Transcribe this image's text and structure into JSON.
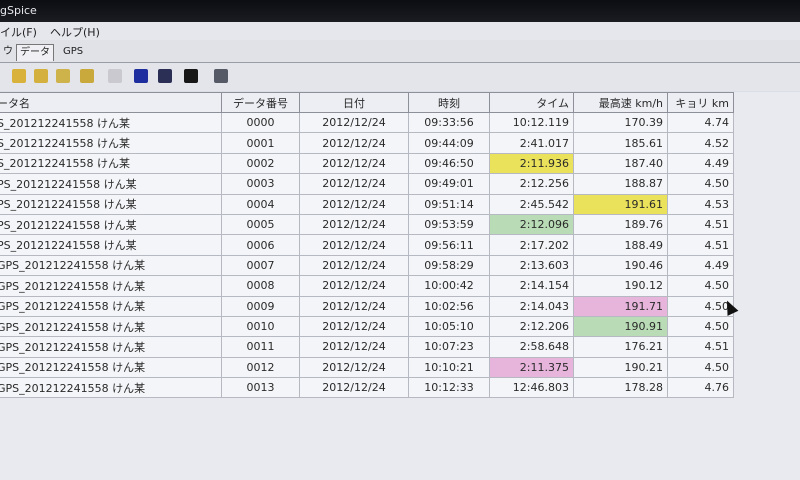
{
  "window": {
    "title": "gSpice"
  },
  "menu": {
    "file": "イル(F)",
    "help": "ヘルプ(H)"
  },
  "tabs": [
    {
      "label": "ウ"
    },
    {
      "label": "データ"
    },
    {
      "label": "GPS"
    }
  ],
  "toolbar": {
    "icons": [
      "open-folder-icon",
      "folder-icon",
      "folder-icon",
      "arrow-icon",
      "edit-icon",
      "save-icon",
      "search-icon",
      "save-icon",
      "table-icon"
    ]
  },
  "colors": {
    "yellow": "#e9e25a",
    "pink": "#e7b5dc",
    "green": "#b9dcb6"
  },
  "table": {
    "headers": [
      "ータ名",
      "データ番号",
      "日付",
      "時刻",
      "タイム",
      "最高速 km/h",
      "キョリ km"
    ],
    "rows": [
      [
        "S_201212241558 けん某",
        "0000",
        "2012/12/24",
        "09:33:56",
        "10:12.119",
        "170.39",
        "4.74"
      ],
      [
        "S_201212241558 けん某",
        "0001",
        "2012/12/24",
        "09:44:09",
        "2:41.017",
        "185.61",
        "4.52"
      ],
      [
        "S_201212241558 けん某",
        "0002",
        "2012/12/24",
        "09:46:50",
        "2:11.936",
        "187.40",
        "4.49"
      ],
      [
        "PS_201212241558 けん某",
        "0003",
        "2012/12/24",
        "09:49:01",
        "2:12.256",
        "188.87",
        "4.50"
      ],
      [
        "PS_201212241558 けん某",
        "0004",
        "2012/12/24",
        "09:51:14",
        "2:45.542",
        "191.61",
        "4.53"
      ],
      [
        "PS_201212241558 けん某",
        "0005",
        "2012/12/24",
        "09:53:59",
        "2:12.096",
        "189.76",
        "4.51"
      ],
      [
        "PS_201212241558 けん某",
        "0006",
        "2012/12/24",
        "09:56:11",
        "2:17.202",
        "188.49",
        "4.51"
      ],
      [
        "GPS_201212241558 けん某",
        "0007",
        "2012/12/24",
        "09:58:29",
        "2:13.603",
        "190.46",
        "4.49"
      ],
      [
        "GPS_201212241558 けん某",
        "0008",
        "2012/12/24",
        "10:00:42",
        "2:14.154",
        "190.12",
        "4.50"
      ],
      [
        "GPS_201212241558 けん某",
        "0009",
        "2012/12/24",
        "10:02:56",
        "2:14.043",
        "191.71",
        "4.50"
      ],
      [
        "GPS_201212241558 けん某",
        "0010",
        "2012/12/24",
        "10:05:10",
        "2:12.206",
        "190.91",
        "4.50"
      ],
      [
        "GPS_201212241558 けん某",
        "0011",
        "2012/12/24",
        "10:07:23",
        "2:58.648",
        "176.21",
        "4.51"
      ],
      [
        "GPS_201212241558 けん某",
        "0012",
        "2012/12/24",
        "10:10:21",
        "2:11.375",
        "190.21",
        "4.50"
      ],
      [
        "GPS_201212241558 けん某",
        "0013",
        "2012/12/24",
        "10:12:33",
        "12:46.803",
        "178.28",
        "4.76"
      ]
    ],
    "highlights": [
      {
        "row": 2,
        "col": 4,
        "color": "yellow"
      },
      {
        "row": 4,
        "col": 5,
        "color": "yellow"
      },
      {
        "row": 5,
        "col": 4,
        "color": "green"
      },
      {
        "row": 9,
        "col": 5,
        "color": "pink"
      },
      {
        "row": 10,
        "col": 5,
        "color": "green"
      },
      {
        "row": 12,
        "col": 4,
        "color": "pink"
      }
    ]
  }
}
